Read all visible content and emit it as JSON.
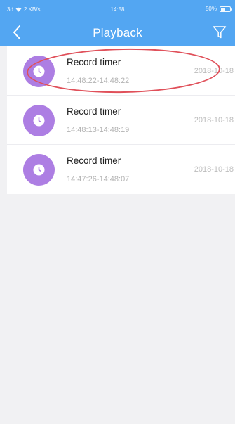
{
  "status_bar": {
    "signal_text": "3d",
    "network_speed": "2 KB/s",
    "time": "14:58",
    "battery_percent": "50%",
    "battery_level": 0.5
  },
  "header": {
    "title": "Playback",
    "back_icon": "chevron-left-icon",
    "filter_icon": "filter-icon"
  },
  "records": [
    {
      "title": "Record timer",
      "time_range": "14:48:22-14:48:22",
      "date": "2018-10-18"
    },
    {
      "title": "Record timer",
      "time_range": "14:48:13-14:48:19",
      "date": "2018-10-18"
    },
    {
      "title": "Record timer",
      "time_range": "14:47:26-14:48:07",
      "date": "2018-10-18"
    }
  ],
  "colors": {
    "header_blue": "#53a6f2",
    "avatar_purple": "#ad7ee3",
    "annotation_red": "#e0505a"
  }
}
